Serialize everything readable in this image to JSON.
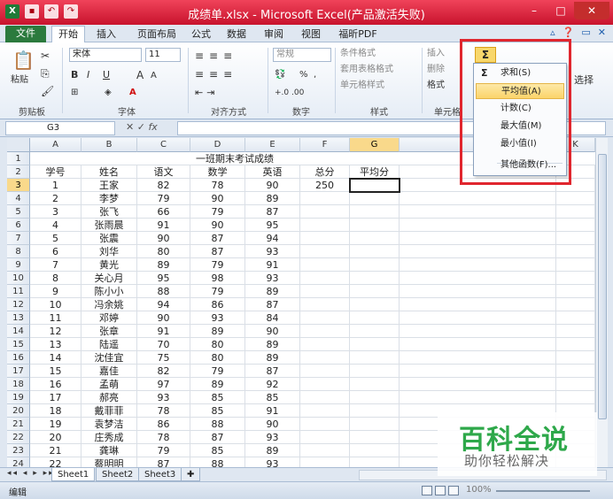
{
  "window": {
    "title": "成绩单.xlsx - Microsoft Excel(产品激活失败)",
    "min": "–",
    "max": "□",
    "close": "✕"
  },
  "tabs": [
    "文件",
    "开始",
    "插入",
    "页面布局",
    "公式",
    "数据",
    "审阅",
    "视图",
    "福昕PDF"
  ],
  "ribbon": {
    "paste": "粘贴",
    "font_name": "宋体",
    "font_size": "11",
    "number_format": "常规",
    "cond_format": "条件格式",
    "table_format": "套用表格格式",
    "cell_style": "单元格样式",
    "insert": "插入",
    "delete": "删除",
    "format": "格式",
    "select_label": "选择",
    "groups": [
      "剪贴板",
      "字体",
      "对齐方式",
      "数字",
      "样式",
      "单元格"
    ],
    "sigma": "Σ"
  },
  "formula_bar": {
    "name_box": "G3",
    "fx": "fx",
    "value": ""
  },
  "autosum_menu": {
    "items": [
      "求和(S)",
      "平均值(A)",
      "计数(C)",
      "最大值(M)",
      "最小值(I)",
      "其他函数(F)..."
    ],
    "highlighted_index": 1
  },
  "sheet": {
    "columns": [
      "A",
      "B",
      "C",
      "D",
      "E",
      "F",
      "G",
      "H",
      "K"
    ],
    "selected_column": "G",
    "selected_row": 3,
    "title": "一班期末考试成绩",
    "headers": [
      "学号",
      "姓名",
      "语文",
      "数学",
      "英语",
      "总分",
      "平均分"
    ],
    "rows": [
      [
        "1",
        "王家",
        "82",
        "78",
        "90",
        "250"
      ],
      [
        "2",
        "李梦",
        "79",
        "90",
        "89",
        ""
      ],
      [
        "3",
        "张飞",
        "66",
        "79",
        "87",
        ""
      ],
      [
        "4",
        "张雨晨",
        "91",
        "90",
        "95",
        ""
      ],
      [
        "5",
        "张震",
        "90",
        "87",
        "94",
        ""
      ],
      [
        "6",
        "刘华",
        "80",
        "87",
        "93",
        ""
      ],
      [
        "7",
        "黄光",
        "89",
        "79",
        "91",
        ""
      ],
      [
        "8",
        "关心月",
        "95",
        "98",
        "93",
        ""
      ],
      [
        "9",
        "陈小小",
        "88",
        "79",
        "89",
        ""
      ],
      [
        "10",
        "冯余姚",
        "94",
        "86",
        "87",
        ""
      ],
      [
        "11",
        "邓婷",
        "90",
        "93",
        "84",
        ""
      ],
      [
        "12",
        "张章",
        "91",
        "89",
        "90",
        ""
      ],
      [
        "13",
        "陆遥",
        "70",
        "80",
        "89",
        ""
      ],
      [
        "14",
        "沈佳宜",
        "75",
        "80",
        "89",
        ""
      ],
      [
        "15",
        "嘉佳",
        "82",
        "79",
        "87",
        ""
      ],
      [
        "16",
        "孟萌",
        "97",
        "89",
        "92",
        ""
      ],
      [
        "17",
        "郝亮",
        "93",
        "85",
        "85",
        ""
      ],
      [
        "18",
        "戴菲菲",
        "78",
        "85",
        "91",
        ""
      ],
      [
        "19",
        "袁梦洁",
        "86",
        "88",
        "90",
        ""
      ],
      [
        "20",
        "庄秀成",
        "78",
        "87",
        "93",
        ""
      ],
      [
        "21",
        "龚琳",
        "79",
        "85",
        "89",
        ""
      ],
      [
        "22",
        "蔡明明",
        "87",
        "88",
        "93",
        ""
      ]
    ]
  },
  "sheet_tabs": [
    "Sheet1",
    "Sheet2",
    "Sheet3"
  ],
  "status": {
    "mode": "编辑",
    "zoom": "100%"
  },
  "watermark": {
    "big": "百科全说",
    "small": "助你轻松解决"
  }
}
